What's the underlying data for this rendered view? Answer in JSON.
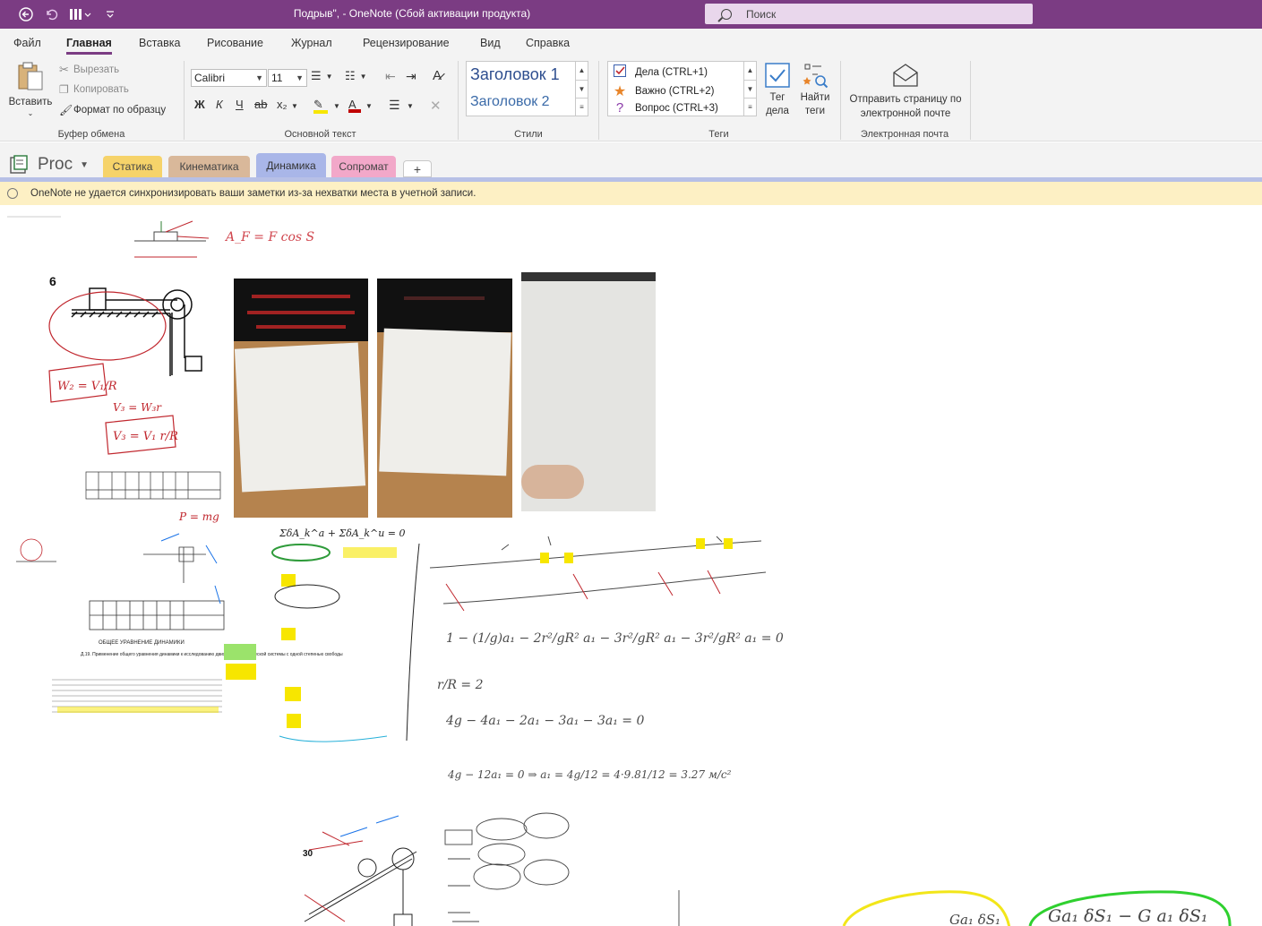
{
  "window": {
    "title": "Подрыв\",  - OneNote (Сбой активации продукта)",
    "search_placeholder": "Поиск"
  },
  "quick_access": [
    "back-icon",
    "undo-icon",
    "touch-mode-icon",
    "customize-icon"
  ],
  "menu": {
    "items": [
      "Файл",
      "Главная",
      "Вставка",
      "Рисование",
      "Журнал",
      "Рецензирование",
      "Вид",
      "Справка"
    ],
    "active": "Главная"
  },
  "ribbon": {
    "clipboard": {
      "paste": "Вставить",
      "cut": "Вырезать",
      "copy": "Копировать",
      "format_painter": "Формат по образцу",
      "label": "Буфер обмена"
    },
    "basic_text": {
      "font": "Calibri",
      "size": "11",
      "bold": "Ж",
      "italic": "К",
      "underline": "Ч",
      "strike": "аb",
      "subscript": "x₂",
      "label": "Основной текст",
      "highlight_color": "#f7e600",
      "font_color": "#c00000"
    },
    "styles": {
      "heading1": "Заголовок 1",
      "heading2": "Заголовок 2",
      "label": "Стили"
    },
    "tags": {
      "items": [
        {
          "label": "Дела (CTRL+1)",
          "icon": "checkbox-icon"
        },
        {
          "label": "Важно (CTRL+2)",
          "icon": "star-icon"
        },
        {
          "label": "Вопрос (CTRL+3)",
          "icon": "question-icon"
        }
      ],
      "todo_tag": "Тег дела",
      "find_tags": "Найти теги",
      "label": "Теги"
    },
    "email": {
      "send": "Отправить страницу по электронной почте",
      "label": "Электронная почта"
    }
  },
  "notebook": {
    "name": "Proc",
    "sections": [
      {
        "label": "Статика",
        "color": "#f6d36a"
      },
      {
        "label": "Кинематика",
        "color": "#d9b89a"
      },
      {
        "label": "Динамика",
        "color": "#a9b6e8",
        "active": true
      },
      {
        "label": "Сопромат",
        "color": "#f2a8c9"
      }
    ],
    "add_label": "+"
  },
  "notice": "OneNote не удается синхронизировать ваши заметки из-за нехватки места в учетной записи.",
  "ink": {
    "formula_af": "A_F = F cos S",
    "w2": "W₂ = V₁/R",
    "w3": "V₃ = W₃r",
    "v3": "V₃ = V₁ r/R",
    "eq1": "ΣδA_k^a + ΣδA_k^u = 0",
    "eq2": "1 − (1/g)a₁ − 2r²/gR² a₁ − 3r²/gR² a₁ − 3r²/gR² a₁ = 0",
    "eq3": "r/R = 2",
    "eq4": "4g − 4a₁ − 2a₁ − 3a₁ − 3a₁ = 0",
    "eq5": "4g − 12a₁ = 0  ⇒  a₁ = 4g/12 = 4·9.81/12 = 3.27 м/с²",
    "p": "P = mg",
    "bottom1": "Ga₁ δS₁",
    "bottom2": "Ga₁ δS₁ − G a₁ δS₁"
  },
  "doc_caption": {
    "title": "ОБЩЕЕ УРАВНЕНИЕ ДИНАМИКИ",
    "subtitle": "Д.19. Применение общего уравнения динамики к исследованию движения механической системы с одной степенью свободы"
  },
  "figure_numbers": {
    "fig6": "6",
    "fig30": "30"
  }
}
